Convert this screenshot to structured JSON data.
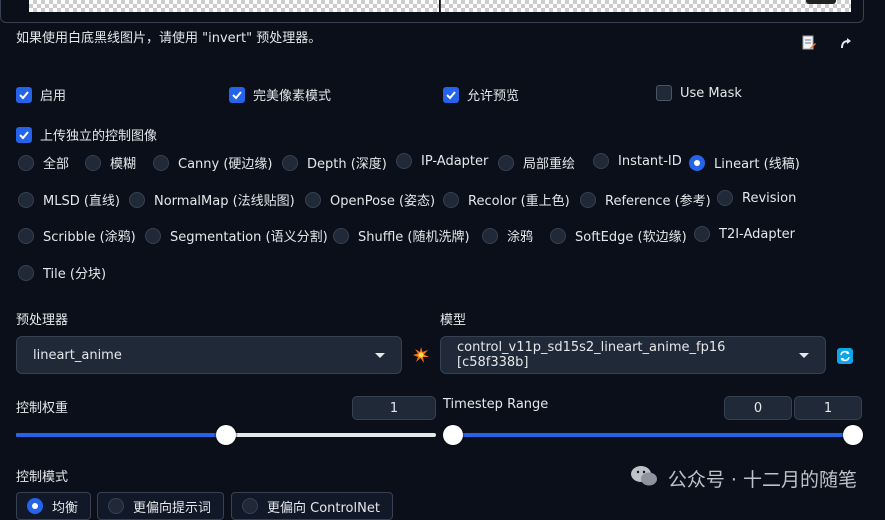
{
  "hint_text": "如果使用白底黑线图片，请使用 \"invert\" 预处理器。",
  "tools": {
    "doc_icon": "document-edit-icon",
    "send_icon": "curved-arrow-icon"
  },
  "options": {
    "enable": {
      "label": "启用",
      "checked": true
    },
    "pixel_perfect": {
      "label": "完美像素模式",
      "checked": true
    },
    "allow_preview": {
      "label": "允许预览",
      "checked": true
    },
    "use_mask": {
      "label": "Use Mask",
      "checked": false
    },
    "upload_independent": {
      "label": "上传独立的控制图像",
      "checked": true
    }
  },
  "control_types": [
    "全部",
    "模糊",
    "Canny (硬边缘)",
    "Depth (深度)",
    "IP-Adapter",
    "局部重绘",
    "Instant-ID",
    "Lineart (线稿)",
    "MLSD (直线)",
    "NormalMap (法线贴图)",
    "OpenPose (姿态)",
    "Recolor (重上色)",
    "Reference (参考)",
    "Revision",
    "Scribble (涂鸦)",
    "Segmentation (语义分割)",
    "Shuffle (随机洗牌)",
    "涂鸦",
    "SoftEdge (软边缘)",
    "T2I-Adapter",
    "Tile (分块)"
  ],
  "selected_control_type": "Lineart (线稿)",
  "preprocessor": {
    "label": "预处理器",
    "value": "lineart_anime"
  },
  "model": {
    "label": "模型",
    "value": "control_v11p_sd15s2_lineart_anime_fp16 [c58f338b]"
  },
  "control_weight": {
    "label": "控制权重",
    "value": "1",
    "fraction": 0.5
  },
  "timestep_range": {
    "label": "Timestep Range",
    "start": "0",
    "end": "1"
  },
  "control_mode": {
    "label": "控制模式",
    "options": [
      "均衡",
      "更偏向提示词",
      "更偏向 ControlNet"
    ],
    "selected": "均衡"
  },
  "watermark": {
    "brand": "公众号 · 十二月的随笔",
    "icon": "wechat-icon"
  },
  "colors": {
    "accent": "#2563eb",
    "background": "#0b0f19",
    "panel": "#1f2937"
  }
}
